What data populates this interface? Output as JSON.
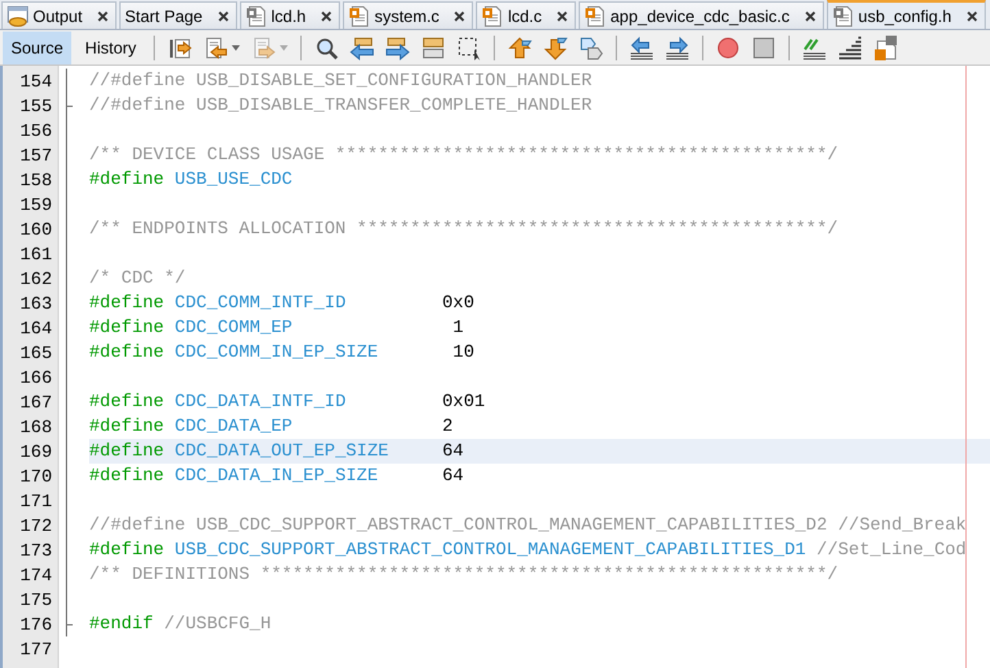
{
  "tabs": [
    {
      "label": "Output",
      "kind": "output",
      "selected": false
    },
    {
      "label": "Start Page",
      "kind": "page",
      "selected": false
    },
    {
      "label": "lcd.h",
      "kind": "header",
      "selected": false
    },
    {
      "label": "system.c",
      "kind": "source",
      "selected": false
    },
    {
      "label": "lcd.c",
      "kind": "source",
      "selected": false
    },
    {
      "label": "app_device_cdc_basic.c",
      "kind": "source",
      "selected": false
    },
    {
      "label": "usb_config.h",
      "kind": "header",
      "selected": true
    }
  ],
  "views": [
    {
      "label": "Source",
      "selected": true
    },
    {
      "label": "History",
      "selected": false
    }
  ],
  "toolbar": [
    {
      "kind": "lastedit",
      "disabled": false,
      "caret": false
    },
    {
      "kind": "back",
      "disabled": false,
      "caret": true
    },
    {
      "kind": "forward",
      "disabled": true,
      "caret": true
    },
    {
      "kind": "separator"
    },
    {
      "kind": "search",
      "disabled": false,
      "caret": false
    },
    {
      "kind": "previous",
      "disabled": false,
      "caret": false
    },
    {
      "kind": "next",
      "disabled": false,
      "caret": false
    },
    {
      "kind": "highlight",
      "disabled": false,
      "caret": false
    },
    {
      "kind": "selection",
      "disabled": false,
      "caret": false
    },
    {
      "kind": "separator"
    },
    {
      "kind": "up",
      "disabled": false,
      "caret": false
    },
    {
      "kind": "down",
      "disabled": false,
      "caret": false
    },
    {
      "kind": "bookmark",
      "disabled": false,
      "caret": false
    },
    {
      "kind": "separator"
    },
    {
      "kind": "outdent",
      "disabled": false,
      "caret": false
    },
    {
      "kind": "indent",
      "disabled": false,
      "caret": false
    },
    {
      "kind": "separator"
    },
    {
      "kind": "record",
      "disabled": false,
      "caret": false
    },
    {
      "kind": "stop",
      "disabled": false,
      "caret": false
    },
    {
      "kind": "separator"
    },
    {
      "kind": "comment",
      "disabled": false,
      "caret": false
    },
    {
      "kind": "uncomment",
      "disabled": false,
      "caret": false
    },
    {
      "kind": "switch",
      "disabled": false,
      "caret": false
    }
  ],
  "lines": [
    {
      "number": "154",
      "fold_end": false,
      "highlighted": false,
      "tokens": [
        {
          "kind": "comment",
          "text": "//#define USB_DISABLE_SET_CONFIGURATION_HANDLER"
        }
      ]
    },
    {
      "number": "155",
      "fold_end": true,
      "highlighted": false,
      "tokens": [
        {
          "kind": "comment",
          "text": "//#define USB_DISABLE_TRANSFER_COMPLETE_HANDLER"
        }
      ]
    },
    {
      "number": "156",
      "fold_end": false,
      "highlighted": false
    },
    {
      "number": "157",
      "fold_end": false,
      "highlighted": false,
      "tokens": [
        {
          "kind": "comment",
          "text": "/** DEVICE CLASS USAGE **********************************************/"
        }
      ]
    },
    {
      "number": "158",
      "fold_end": false,
      "highlighted": false,
      "tokens": [
        {
          "kind": "directive",
          "text": "#define"
        },
        {
          "kind": "macro",
          "text": " USB_USE_CDC"
        }
      ]
    },
    {
      "number": "159",
      "fold_end": false,
      "highlighted": false
    },
    {
      "number": "160",
      "fold_end": false,
      "highlighted": false,
      "tokens": [
        {
          "kind": "comment",
          "text": "/** ENDPOINTS ALLOCATION ********************************************/"
        }
      ]
    },
    {
      "number": "161",
      "fold_end": false,
      "highlighted": false
    },
    {
      "number": "162",
      "fold_end": false,
      "highlighted": false,
      "tokens": [
        {
          "kind": "comment",
          "text": "/* CDC */"
        }
      ]
    },
    {
      "number": "163",
      "fold_end": false,
      "highlighted": false,
      "tokens": [
        {
          "kind": "directive",
          "text": "#define"
        },
        {
          "kind": "macro",
          "text": " CDC_COMM_INTF_ID"
        },
        {
          "kind": "number",
          "text": "         0x0"
        }
      ]
    },
    {
      "number": "164",
      "fold_end": false,
      "highlighted": false,
      "tokens": [
        {
          "kind": "directive",
          "text": "#define"
        },
        {
          "kind": "macro",
          "text": " CDC_COMM_EP"
        },
        {
          "kind": "number",
          "text": "               1"
        }
      ]
    },
    {
      "number": "165",
      "fold_end": false,
      "highlighted": false,
      "tokens": [
        {
          "kind": "directive",
          "text": "#define"
        },
        {
          "kind": "macro",
          "text": " CDC_COMM_IN_EP_SIZE"
        },
        {
          "kind": "number",
          "text": "       10"
        }
      ]
    },
    {
      "number": "166",
      "fold_end": false,
      "highlighted": false
    },
    {
      "number": "167",
      "fold_end": false,
      "highlighted": false,
      "tokens": [
        {
          "kind": "directive",
          "text": "#define"
        },
        {
          "kind": "macro",
          "text": " CDC_DATA_INTF_ID"
        },
        {
          "kind": "number",
          "text": "         0x01"
        }
      ]
    },
    {
      "number": "168",
      "fold_end": false,
      "highlighted": false,
      "tokens": [
        {
          "kind": "directive",
          "text": "#define"
        },
        {
          "kind": "macro",
          "text": " CDC_DATA_EP"
        },
        {
          "kind": "number",
          "text": "              2"
        }
      ]
    },
    {
      "number": "169",
      "fold_end": false,
      "highlighted": true,
      "tokens": [
        {
          "kind": "directive",
          "text": "#define"
        },
        {
          "kind": "macro",
          "text": " CDC_DATA_OUT_EP_SIZE"
        },
        {
          "kind": "number",
          "text": "     64"
        }
      ]
    },
    {
      "number": "170",
      "fold_end": false,
      "highlighted": false,
      "tokens": [
        {
          "kind": "directive",
          "text": "#define"
        },
        {
          "kind": "macro",
          "text": " CDC_DATA_IN_EP_SIZE"
        },
        {
          "kind": "number",
          "text": "      64"
        }
      ]
    },
    {
      "number": "171",
      "fold_end": false,
      "highlighted": false
    },
    {
      "number": "172",
      "fold_end": false,
      "highlighted": false,
      "tokens": [
        {
          "kind": "comment",
          "text": "//#define USB_CDC_SUPPORT_ABSTRACT_CONTROL_MANAGEMENT_CAPABILITIES_D2 //Send_Break"
        }
      ]
    },
    {
      "number": "173",
      "fold_end": false,
      "highlighted": false,
      "tokens": [
        {
          "kind": "directive",
          "text": "#define"
        },
        {
          "kind": "macro",
          "text": " USB_CDC_SUPPORT_ABSTRACT_CONTROL_MANAGEMENT_CAPABILITIES_D1"
        },
        {
          "kind": "comment",
          "text": " //Set_Line_Cod"
        }
      ]
    },
    {
      "number": "174",
      "fold_end": false,
      "highlighted": false,
      "tokens": [
        {
          "kind": "comment",
          "text": "/** DEFINITIONS *****************************************************/"
        }
      ]
    },
    {
      "number": "175",
      "fold_end": false,
      "highlighted": false
    },
    {
      "number": "176",
      "fold_end": true,
      "highlighted": false,
      "tokens": [
        {
          "kind": "directive",
          "text": "#endif"
        },
        {
          "kind": "comment",
          "text": " //USBCFG_H"
        }
      ]
    },
    {
      "number": "177",
      "fold_end": false,
      "highlighted": false
    }
  ]
}
